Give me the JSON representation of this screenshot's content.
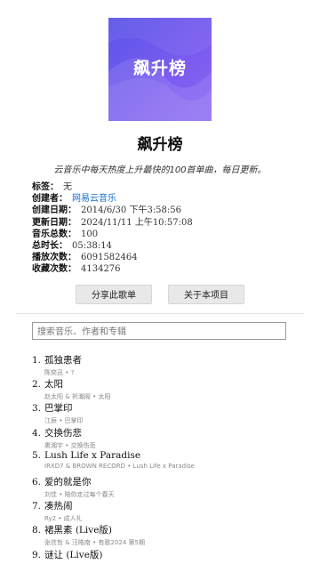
{
  "playlist": {
    "cover_text": "飙升榜",
    "title": "飙升榜",
    "description": "云音乐中每天热度上升最快的100首单曲，每日更新。"
  },
  "meta": {
    "tags": {
      "key": "标签：",
      "value": "无"
    },
    "creator": {
      "key": "创建者：",
      "value": "网易云音乐"
    },
    "created": {
      "key": "创建日期：",
      "value": "2014/6/30 下午3:58:56"
    },
    "updated": {
      "key": "更新日期：",
      "value": "2024/11/11 上午10:57:08"
    },
    "track_count": {
      "key": "音乐总数：",
      "value": "100"
    },
    "duration": {
      "key": "总时长：",
      "value": "05:38:14"
    },
    "plays": {
      "key": "播放次数：",
      "value": "6091582464"
    },
    "favorites": {
      "key": "收藏次数：",
      "value": "4134276"
    }
  },
  "buttons": {
    "share": "分享此歌单",
    "about": "关于本项目"
  },
  "search": {
    "placeholder": "搜索音乐、作者和专辑"
  },
  "tracks": [
    {
      "num": "1.",
      "title": "孤独患者",
      "sub": "陈奕迅 • ?"
    },
    {
      "num": "2.",
      "title": "太阳",
      "sub": "赵太阳 & 祈潮阁 • 太阳"
    },
    {
      "num": "3.",
      "title": "巴掌印",
      "sub": "江辰 • 巴掌印"
    },
    {
      "num": "4.",
      "title": "交换伤悲",
      "sub": "裹湘宇 • 交换伤悲"
    },
    {
      "num": "5.",
      "title": "Lush Life x Paradise",
      "sub": "IRXD7 & BROWN RECORD • Lush Life x Paradise"
    },
    {
      "num": "6.",
      "title": "爱的就是你",
      "sub": "刘佳 • 陪你走过每个春天"
    },
    {
      "num": "7.",
      "title": "凑热闹",
      "sub": "Ry2 • 成人礼"
    },
    {
      "num": "8.",
      "title": "裙黑素 (Live版)",
      "sub": "张信哲 & 汪皓南 • 有歌2024 第5期"
    },
    {
      "num": "9.",
      "title": "谜让 (Live版)",
      "sub": ""
    }
  ]
}
